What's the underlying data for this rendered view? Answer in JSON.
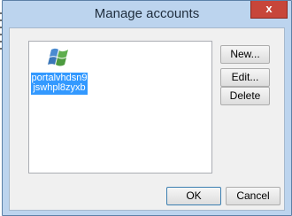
{
  "window": {
    "title": "Manage accounts",
    "close_label": "x"
  },
  "accounts": [
    {
      "name": "portalvhdsn9jswhpl8zyxb",
      "icon": "windows-azure-icon",
      "selected": true
    }
  ],
  "buttons": {
    "new": "New...",
    "edit": "Edit...",
    "delete": "Delete",
    "ok": "OK",
    "cancel": "Cancel"
  },
  "colors": {
    "frame": "#bcd4ee",
    "close": "#c7463a",
    "selection": "#3399ff"
  }
}
